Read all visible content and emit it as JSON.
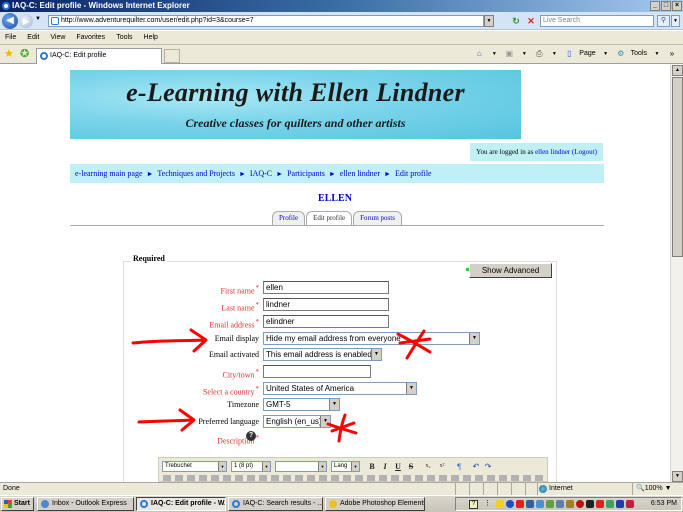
{
  "window": {
    "title": "IAQ-C: Edit profile - Windows Internet Explorer",
    "controls": [
      "_",
      "□",
      "×"
    ]
  },
  "browser": {
    "url": "http://www.adventurequilter.com/user/edit.php?id=3&course=7",
    "search_placeholder": "Live Search",
    "menu": [
      "File",
      "Edit",
      "View",
      "Favorites",
      "Tools",
      "Help"
    ],
    "tab_title": "IAQ-C: Edit profile",
    "command_bar": {
      "page_label": "Page",
      "tools_label": "Tools"
    }
  },
  "page": {
    "banner": {
      "title": "e-Learning with Ellen Lindner",
      "subtitle": "Creative classes for quilters and other artists"
    },
    "login_info": {
      "prefix": "You are logged in as ",
      "user": "ellen lindner",
      "logout": "(Logout)"
    },
    "breadcrumb": [
      "e-learning main page",
      "Techniques and Projects",
      "IAQ-C",
      "Participants",
      "ellen lindner",
      "Edit profile"
    ],
    "breadcrumb_separator": "►",
    "profile_name": "ELLEN",
    "tabs": [
      {
        "label": "Profile",
        "active": false
      },
      {
        "label": "Edit profile",
        "active": true
      },
      {
        "label": "Forum posts",
        "active": false
      }
    ],
    "form": {
      "section_legend": "Required",
      "show_advanced_label": "Show Advanced",
      "fields": {
        "first_name": {
          "label": "First name",
          "required": true,
          "value": "ellen"
        },
        "last_name": {
          "label": "Last name",
          "required": true,
          "value": "lindner"
        },
        "email": {
          "label": "Email address",
          "required": true,
          "value": "elindner"
        },
        "email_display": {
          "label": "Email display",
          "required": false,
          "value": "Hide my email address from everyone"
        },
        "email_activated": {
          "label": "Email activated",
          "required": false,
          "value": "This email address is enabled"
        },
        "city": {
          "label": "City/town",
          "required": true,
          "value": ""
        },
        "country": {
          "label": "Select a country",
          "required": true,
          "value": "United States of America"
        },
        "timezone": {
          "label": "Timezone",
          "required": false,
          "value": "GMT-5"
        },
        "language": {
          "label": "Preferred language",
          "required": false,
          "value": "English (en_us)"
        },
        "description": {
          "label": "Description",
          "required": true
        }
      },
      "required_mark": "*",
      "help_icon": "?",
      "editor_toolbar": {
        "font": "Trebuchet",
        "size": "1 (8 pt)",
        "format": "",
        "lang": "Lang",
        "buttons": [
          "B",
          "I",
          "U",
          "S",
          "x₂",
          "x²",
          "¶",
          "↶",
          "↷"
        ]
      }
    }
  },
  "statusbar": {
    "status": "Done",
    "zone": "Internet",
    "zoom": "100%"
  },
  "taskbar": {
    "start_label": "Start",
    "tasks": [
      {
        "label": "Inbox - Outlook Express",
        "active": false
      },
      {
        "label": "IAQ-C: Edit profile - W...",
        "active": true
      },
      {
        "label": "IAQ-C: Search results - ...",
        "active": false
      },
      {
        "label": "Adobe Photoshop Elements",
        "active": false
      }
    ],
    "clock": "6:53 PM"
  },
  "scrollbar": {
    "position_fraction": 0.0,
    "visible_fraction": 0.45
  },
  "colors": {
    "link": "#0000cc",
    "required": "#e03030",
    "nav_bg": "#bff0f6",
    "annotation": "#ff0000"
  }
}
